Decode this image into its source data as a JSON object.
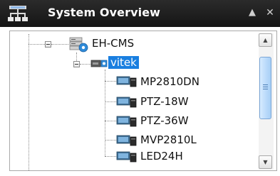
{
  "window": {
    "title": "System Overview",
    "title_icon": "network-topology-icon",
    "pin_glyph": "▲",
    "close_glyph": "✕"
  },
  "tree": {
    "root": {
      "label": "EH-CMS",
      "icon": "server-group-icon",
      "expanded": true
    },
    "group": {
      "label": "vitek",
      "icon": "dvr-device-icon",
      "expanded": true,
      "selected": true
    },
    "devices": [
      {
        "label": "MP2810DN",
        "icon": "camera-icon"
      },
      {
        "label": "PTZ-18W",
        "icon": "camera-icon"
      },
      {
        "label": "PTZ-36W",
        "icon": "camera-icon"
      },
      {
        "label": "MVP2810L",
        "icon": "camera-icon"
      },
      {
        "label": "LED24H",
        "icon": "camera-icon"
      }
    ]
  },
  "scrollbar": {
    "up_glyph": "▲",
    "down_glyph": "▼",
    "position_fraction": 0.2
  },
  "colors": {
    "titlebar": "#1e1e1e",
    "selection": "#1a7fe0",
    "thumb": "#bddcfb"
  }
}
